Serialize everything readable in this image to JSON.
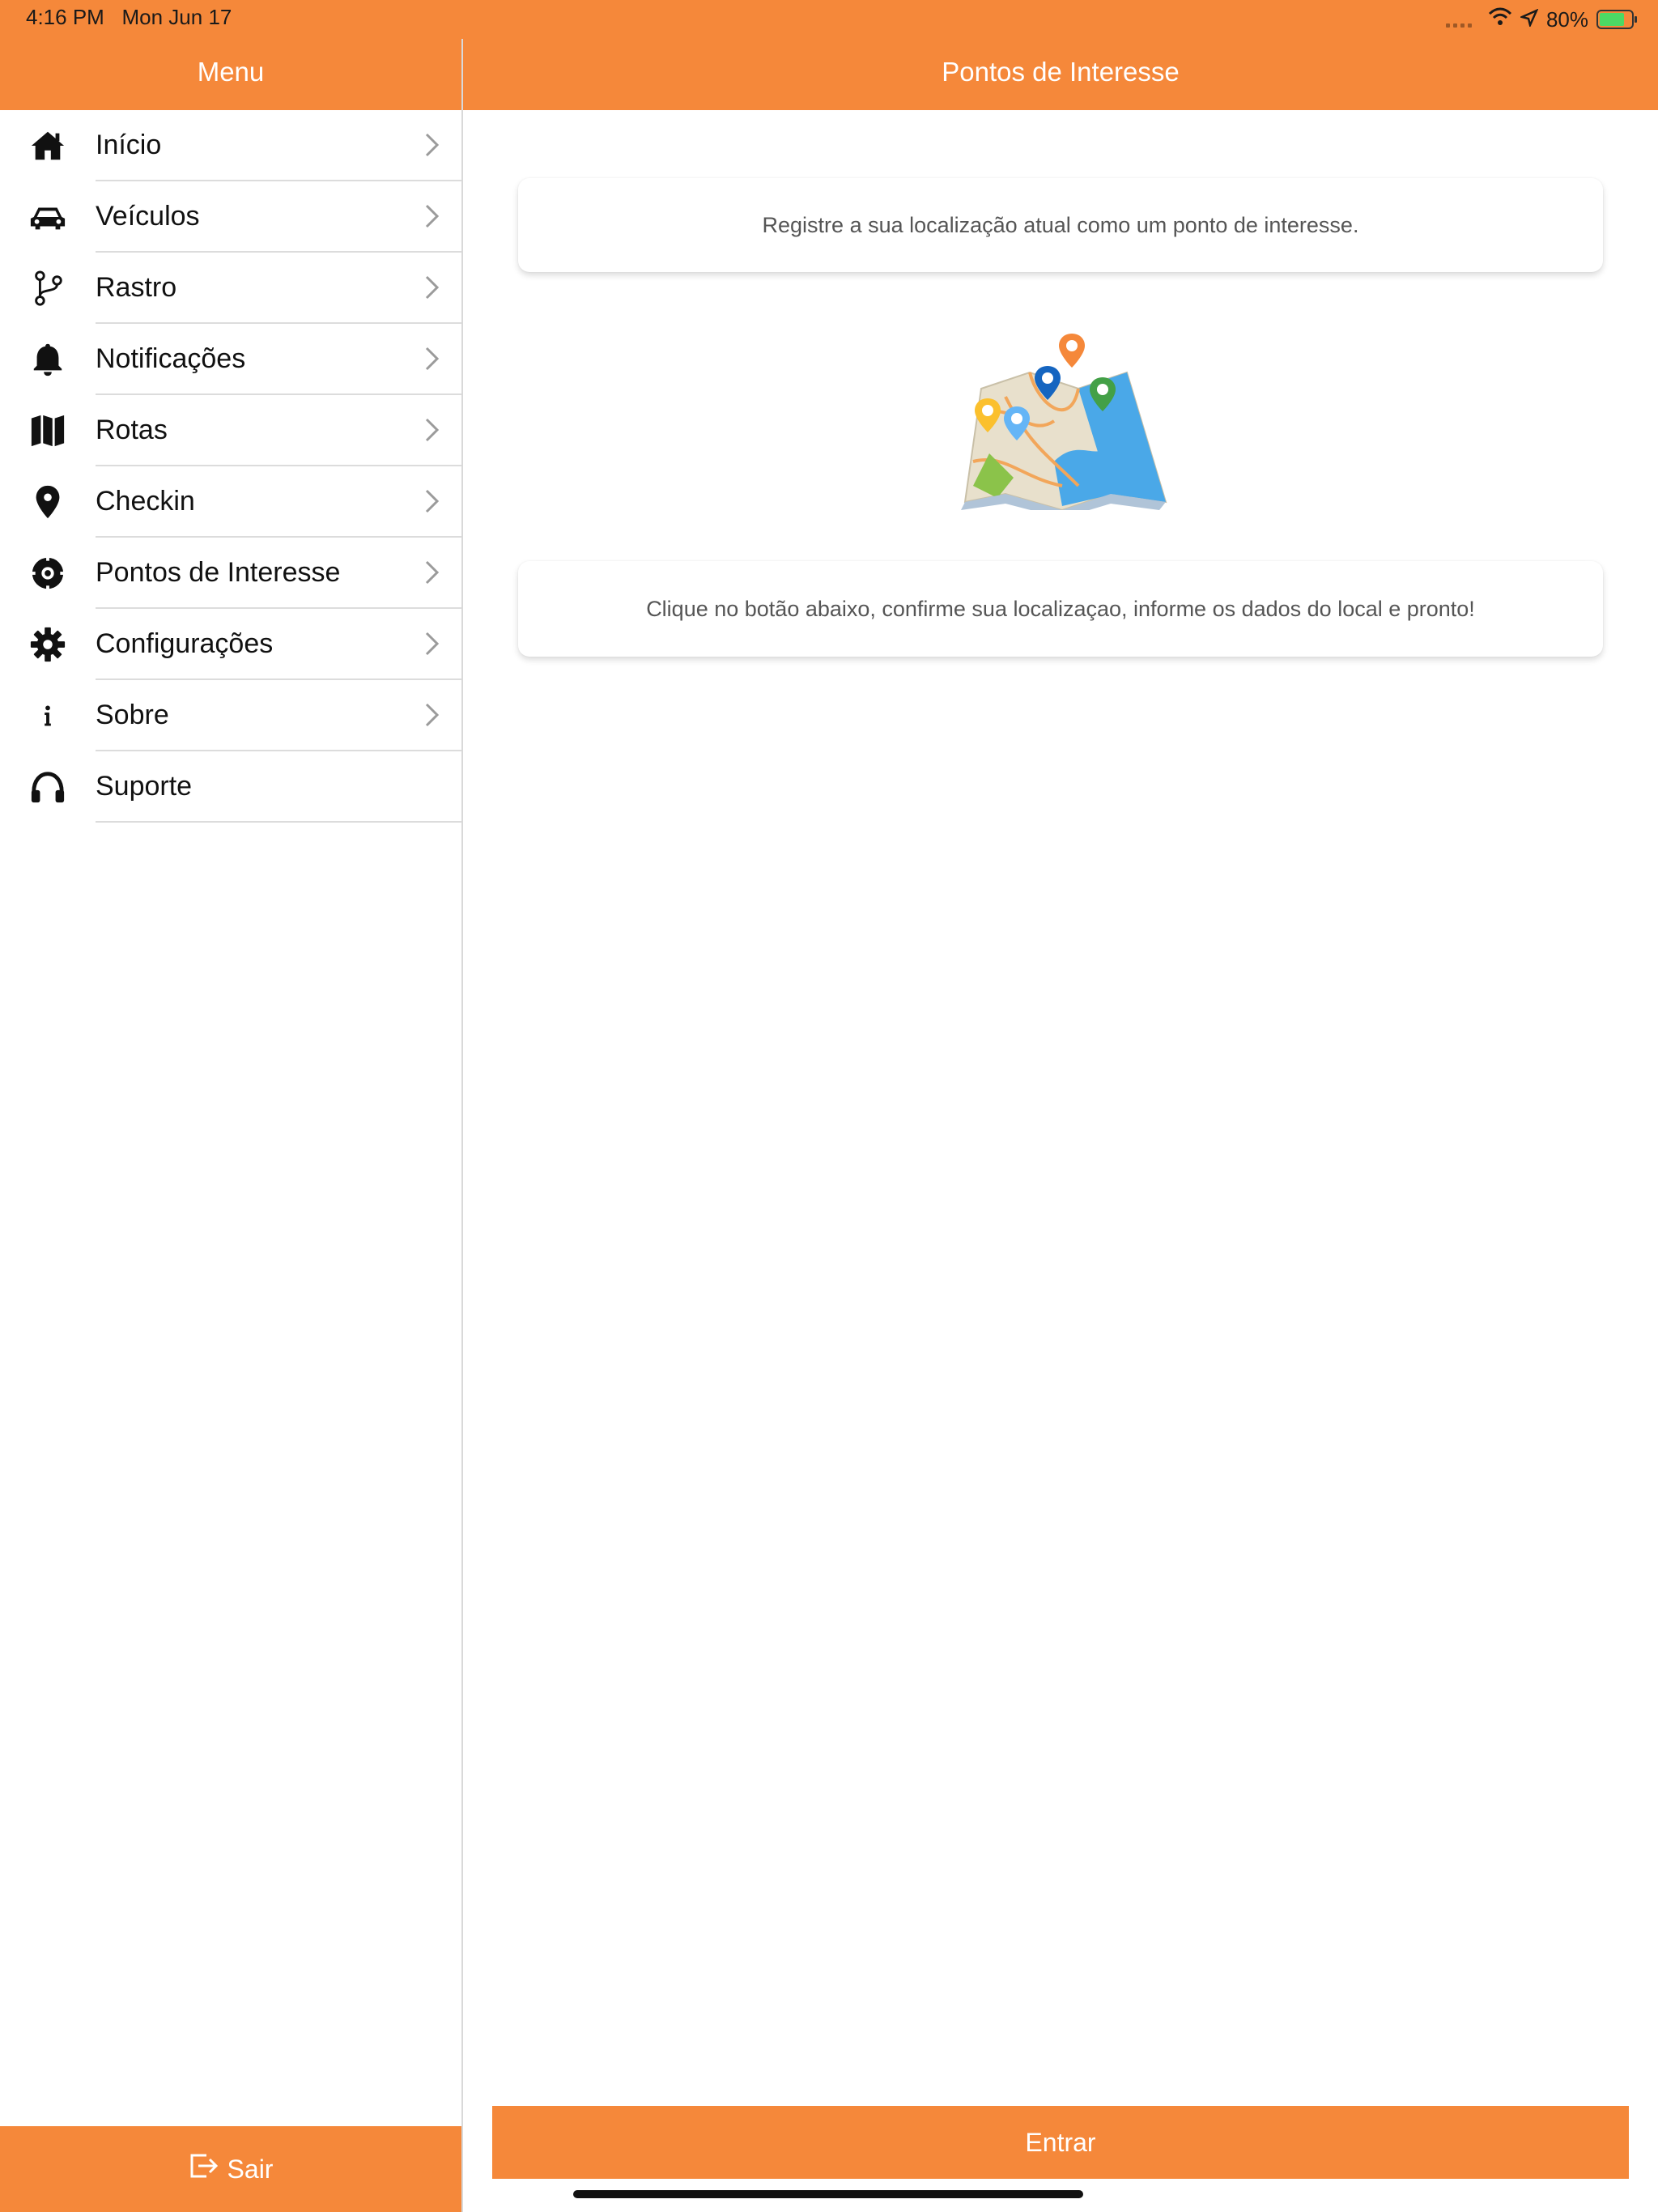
{
  "status_bar": {
    "time": "4:16 PM",
    "date": "Mon Jun 17",
    "battery": "80%",
    "battery_level": 0.8
  },
  "sidebar": {
    "title": "Menu",
    "items": [
      {
        "label": "Início",
        "icon": "home-icon"
      },
      {
        "label": "Veículos",
        "icon": "car-icon"
      },
      {
        "label": "Rastro",
        "icon": "branch-icon"
      },
      {
        "label": "Notificações",
        "icon": "bell-icon"
      },
      {
        "label": "Rotas",
        "icon": "map-icon"
      },
      {
        "label": "Checkin",
        "icon": "map-pin-icon"
      },
      {
        "label": "Pontos de Interesse",
        "icon": "target-icon"
      },
      {
        "label": "Configurações",
        "icon": "gear-icon"
      },
      {
        "label": "Sobre",
        "icon": "info-icon"
      },
      {
        "label": "Suporte",
        "icon": "headphones-icon"
      }
    ],
    "footer_label": "Sair"
  },
  "main": {
    "title": "Pontos de Interesse",
    "card1_text": "Registre a sua localização atual como um ponto de interesse.",
    "card2_text": "Clique no botão abaixo, confirme sua localizaçao, informe os dados do local e pronto!",
    "button_label": "Entrar"
  },
  "colors": {
    "accent": "#F5883A",
    "text": "#111111",
    "muted_text": "#555555"
  }
}
